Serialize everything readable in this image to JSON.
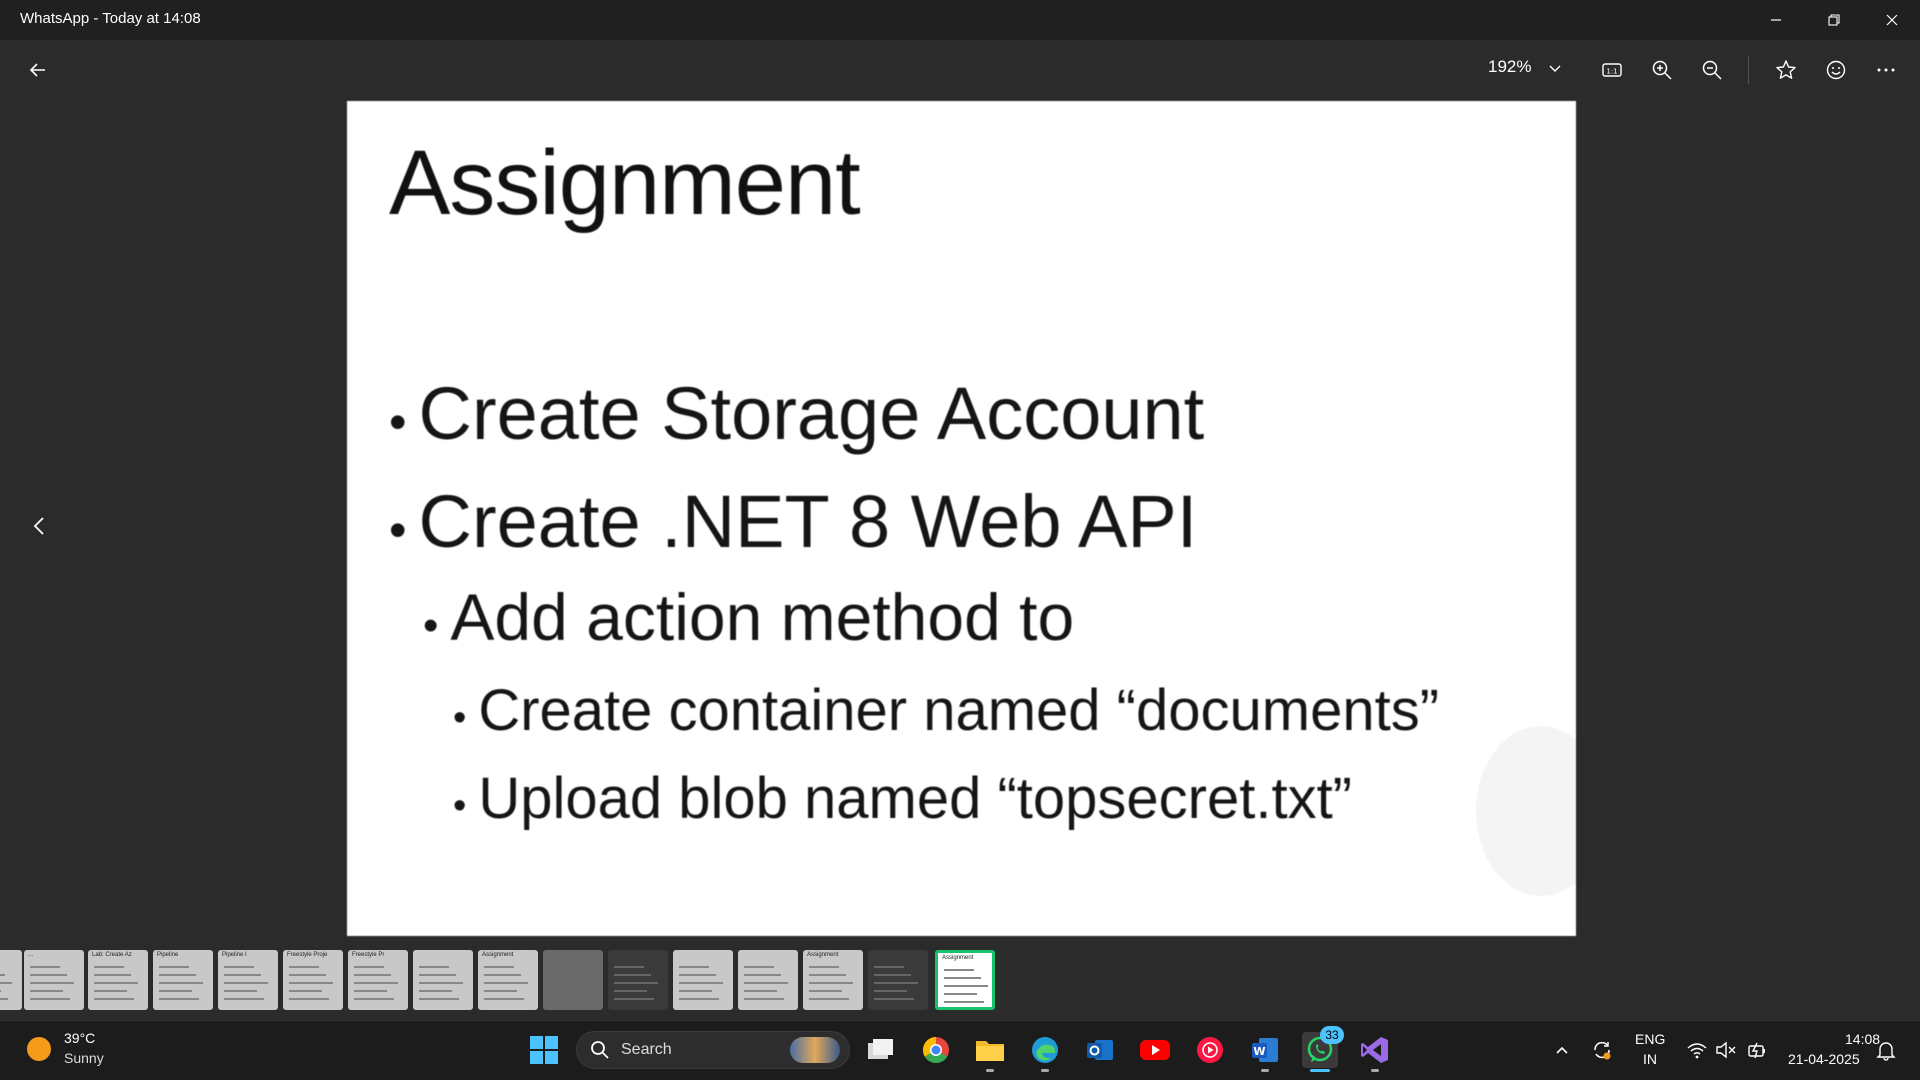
{
  "window": {
    "title": "WhatsApp - Today at 14:08",
    "minimize_icon": "minimize-icon",
    "restore_icon": "restore-icon",
    "close_icon": "close-icon"
  },
  "toolbar": {
    "back_icon": "arrow-left-icon",
    "zoom": "192%",
    "zoom_chevron_icon": "chevron-down-icon",
    "actual_size_icon": "actual-size-icon",
    "zoom_in_icon": "zoom-in-icon",
    "zoom_out_icon": "zoom-out-icon",
    "favorite_icon": "star-icon",
    "react_icon": "smiley-icon",
    "more_icon": "more-icon"
  },
  "slide": {
    "title": "Assignment",
    "bullet_char": "•",
    "bullets": [
      "Create Storage Account",
      "Create .NET 8 Web API",
      "Add action method to",
      "Create container named “documents”",
      "Upload blob named “topsecret.txt”"
    ]
  },
  "navigation": {
    "previous_icon": "chevron-left-icon"
  },
  "filmstrip": {
    "thumb_labels": [
      "...",
      "...",
      "Lab: Create Az",
      "Pipeline",
      "Pipeline I",
      "Freestyle Proje",
      "Freestyle Pr",
      "",
      "Assignment",
      "",
      "",
      "",
      "",
      "Assignment",
      "",
      "Assignment"
    ],
    "active_index": 15
  },
  "taskbar": {
    "weather": {
      "temp": "39°C",
      "condition": "Sunny"
    },
    "search_label": "Search",
    "whatsapp_badge": "33",
    "language": {
      "line1": "ENG",
      "line2": "IN"
    },
    "clock": {
      "time": "14:08",
      "date": "21-04-2025"
    }
  },
  "colors": {
    "accent": "#4cc2ff",
    "active_thumb_border": "#16c26a",
    "background": "#2b2b2b"
  }
}
